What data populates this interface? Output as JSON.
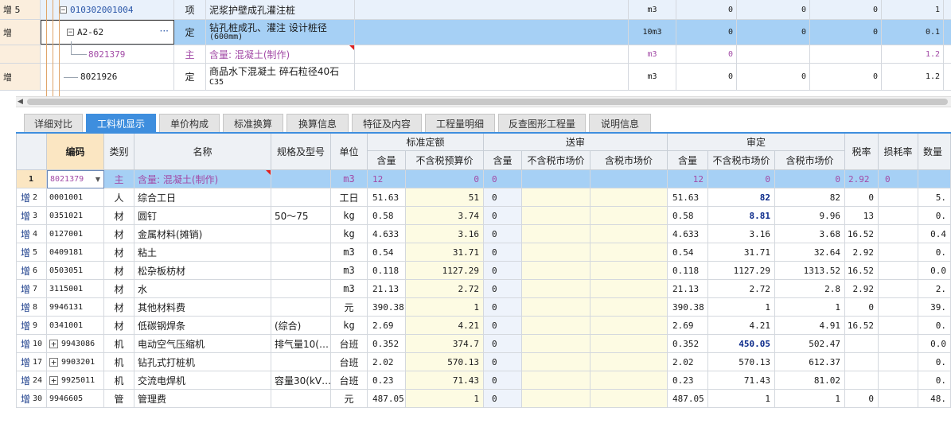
{
  "colors": {
    "accent": "#3e8ede",
    "selected_row": "#a6d0f5",
    "main_material_text": "#a24aa6",
    "highlight_bold": "#0b2a8a"
  },
  "top_grid": {
    "rows": [
      {
        "flag": "增 5",
        "expander": "−",
        "code": "010302001004",
        "type": "项",
        "name": "泥浆护壁成孔灌注桩",
        "unit": "m3",
        "v1": "0",
        "v2": "0",
        "v3": "0",
        "v4": "1"
      },
      {
        "flag": "增",
        "expander": "−",
        "code": "A2-62",
        "ellipsis": "···",
        "type": "定",
        "name": "钻孔桩成孔、灌注 设计桩径",
        "name2": "(600mm)",
        "unit": "10m3",
        "v1": "0",
        "v2": "0",
        "v3": "0",
        "v4": "0.1"
      },
      {
        "flag": "",
        "code": "8021379",
        "type": "主",
        "name": "含量: 混凝土(制作)",
        "unit": "m3",
        "v1": "0",
        "v2": "",
        "v3": "",
        "v4": "1.2"
      },
      {
        "flag": "增",
        "code": "8021926",
        "type": "定",
        "name": "商品水下混凝土 碎石粒径40石",
        "name2": "C35",
        "unit": "m3",
        "v1": "0",
        "v2": "0",
        "v3": "0",
        "v4": "1.2"
      }
    ]
  },
  "tabs": [
    "详细对比",
    "工料机显示",
    "单价构成",
    "标准换算",
    "换算信息",
    "特征及内容",
    "工程量明细",
    "反查图形工程量",
    "说明信息"
  ],
  "active_tab": "工料机显示",
  "grid": {
    "headers": {
      "code": "编码",
      "category": "类别",
      "name": "名称",
      "spec": "规格及型号",
      "unit": "单位",
      "std_group": "标准定额",
      "sub_group": "送审",
      "aud_group": "审定",
      "std_qty": "含量",
      "std_price": "不含税预算价",
      "sub_qty": "含量",
      "sub_market_ex": "不含税市场价",
      "sub_market_in": "含税市场价",
      "aud_qty": "含量",
      "aud_market_ex": "不含税市场价",
      "aud_market_in": "含税市场价",
      "tax": "税率",
      "loss": "损耗率",
      "qty": "数量"
    },
    "rows": [
      {
        "rowno": "1",
        "flag": "",
        "code": "8021379",
        "category": "主",
        "name": "含量: 混凝土(制作)",
        "spec": "",
        "unit": "m3",
        "std_qty": "12",
        "std_price": "0",
        "sub_qty": "0",
        "aud_qty": "12",
        "aud_ex": "0",
        "aud_in": "0",
        "tax": "2.92",
        "loss": "0",
        "qty": ""
      },
      {
        "rowno": "2",
        "flag": "增",
        "code": "0001001",
        "category": "人",
        "name": "综合工日",
        "spec": "",
        "unit": "工日",
        "std_qty": "51.63",
        "std_price": "51",
        "sub_qty": "0",
        "aud_qty": "51.63",
        "aud_ex": "82",
        "aud_in": "82",
        "tax": "0",
        "loss": "",
        "qty": "5."
      },
      {
        "rowno": "3",
        "flag": "增",
        "code": "0351021",
        "category": "材",
        "name": "圆钉",
        "spec": "50～75",
        "unit": "kg",
        "std_qty": "0.58",
        "std_price": "3.74",
        "sub_qty": "0",
        "aud_qty": "0.58",
        "aud_ex": "8.81",
        "aud_in": "9.96",
        "tax": "13",
        "loss": "",
        "qty": "0."
      },
      {
        "rowno": "4",
        "flag": "增",
        "code": "0127001",
        "category": "材",
        "name": "金属材料(摊销)",
        "spec": "",
        "unit": "kg",
        "std_qty": "4.633",
        "std_price": "3.16",
        "sub_qty": "0",
        "aud_qty": "4.633",
        "aud_ex": "3.16",
        "aud_in": "3.68",
        "tax": "16.52",
        "loss": "",
        "qty": "0.4"
      },
      {
        "rowno": "5",
        "flag": "增",
        "code": "0409181",
        "category": "材",
        "name": "粘土",
        "spec": "",
        "unit": "m3",
        "std_qty": "0.54",
        "std_price": "31.71",
        "sub_qty": "0",
        "aud_qty": "0.54",
        "aud_ex": "31.71",
        "aud_in": "32.64",
        "tax": "2.92",
        "loss": "",
        "qty": "0."
      },
      {
        "rowno": "6",
        "flag": "增",
        "code": "0503051",
        "category": "材",
        "name": "松杂板枋材",
        "spec": "",
        "unit": "m3",
        "std_qty": "0.118",
        "std_price": "1127.29",
        "sub_qty": "0",
        "aud_qty": "0.118",
        "aud_ex": "1127.29",
        "aud_in": "1313.52",
        "tax": "16.52",
        "loss": "",
        "qty": "0.0"
      },
      {
        "rowno": "7",
        "flag": "增",
        "code": "3115001",
        "category": "材",
        "name": "水",
        "spec": "",
        "unit": "m3",
        "std_qty": "21.13",
        "std_price": "2.72",
        "sub_qty": "0",
        "aud_qty": "21.13",
        "aud_ex": "2.72",
        "aud_in": "2.8",
        "tax": "2.92",
        "loss": "",
        "qty": "2."
      },
      {
        "rowno": "8",
        "flag": "增",
        "code": "9946131",
        "category": "材",
        "name": "其他材料费",
        "spec": "",
        "unit": "元",
        "std_qty": "390.38",
        "std_price": "1",
        "sub_qty": "0",
        "aud_qty": "390.38",
        "aud_ex": "1",
        "aud_in": "1",
        "tax": "0",
        "loss": "",
        "qty": "39."
      },
      {
        "rowno": "9",
        "flag": "增",
        "code": "0341001",
        "category": "材",
        "name": "低碳钢焊条",
        "spec": "(综合)",
        "unit": "kg",
        "std_qty": "2.69",
        "std_price": "4.21",
        "sub_qty": "0",
        "aud_qty": "2.69",
        "aud_ex": "4.21",
        "aud_in": "4.91",
        "tax": "16.52",
        "loss": "",
        "qty": "0."
      },
      {
        "rowno": "10",
        "flag": "增",
        "expander": "+",
        "code": "9943086",
        "category": "机",
        "name": "电动空气压缩机",
        "spec": "排气量10(…",
        "unit": "台班",
        "std_qty": "0.352",
        "std_price": "374.7",
        "sub_qty": "0",
        "aud_qty": "0.352",
        "aud_ex": "450.05",
        "aud_in": "502.47",
        "tax": "",
        "loss": "",
        "qty": "0.0"
      },
      {
        "rowno": "17",
        "flag": "增",
        "expander": "+",
        "code": "9903201",
        "category": "机",
        "name": "钻孔式打桩机",
        "spec": "",
        "unit": "台班",
        "std_qty": "2.02",
        "std_price": "570.13",
        "sub_qty": "0",
        "aud_qty": "2.02",
        "aud_ex": "570.13",
        "aud_in": "612.37",
        "tax": "",
        "loss": "",
        "qty": "0."
      },
      {
        "rowno": "24",
        "flag": "增",
        "expander": "+",
        "code": "9925011",
        "category": "机",
        "name": "交流电焊机",
        "spec": "容量30(kV…",
        "unit": "台班",
        "std_qty": "0.23",
        "std_price": "71.43",
        "sub_qty": "0",
        "aud_qty": "0.23",
        "aud_ex": "71.43",
        "aud_in": "81.02",
        "tax": "",
        "loss": "",
        "qty": "0."
      },
      {
        "rowno": "30",
        "flag": "增",
        "code": "9946605",
        "category": "管",
        "name": "管理费",
        "spec": "",
        "unit": "元",
        "std_qty": "487.05",
        "std_price": "1",
        "sub_qty": "0",
        "aud_qty": "487.05",
        "aud_ex": "1",
        "aud_in": "1",
        "tax": "0",
        "loss": "",
        "qty": "48."
      }
    ]
  }
}
